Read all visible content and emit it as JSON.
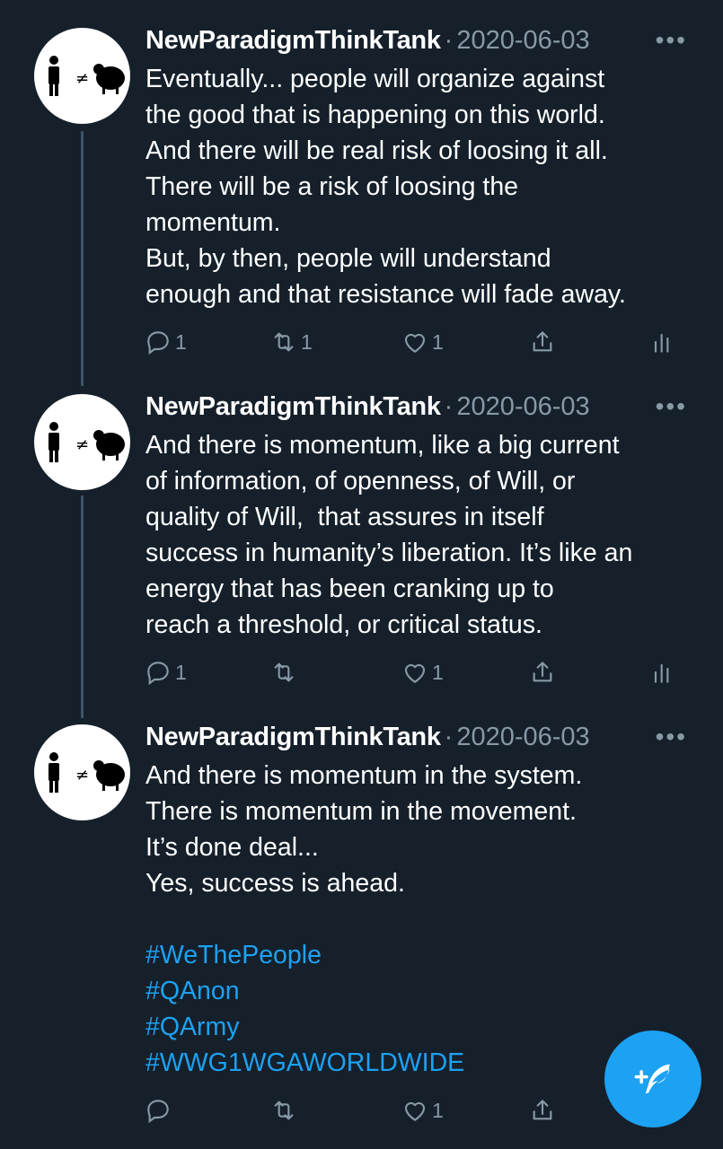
{
  "tweets": [
    {
      "name": "NewParadigmThinkTank",
      "separator": "·",
      "date": "2020-06-03",
      "more": "•••",
      "text": "Eventually... people will organize against\nthe good that is happening on this world.\nAnd there will be real risk of loosing it all.\nThere will be a risk of loosing the\nmomentum.\nBut, by then, people will understand\nenough and that resistance will fade away.",
      "hashtags": [],
      "reply_count": "1",
      "retweet_count": "1",
      "like_count": "1"
    },
    {
      "name": "NewParadigmThinkTank",
      "separator": "·",
      "date": "2020-06-03",
      "more": "•••",
      "text": "And there is momentum, like a big current\nof information, of openness, of Will, or\nquality of Will,  that assures in itself\nsuccess in humanity’s liberation. It’s like an\nenergy that has been cranking up to\nreach a threshold, or critical status.",
      "hashtags": [],
      "reply_count": "1",
      "retweet_count": "",
      "like_count": "1"
    },
    {
      "name": "NewParadigmThinkTank",
      "separator": "·",
      "date": "2020-06-03",
      "more": "•••",
      "text": "And there is momentum in the system.\nThere is momentum in the movement.\nIt’s done deal...\nYes, success is ahead.",
      "hashtags": [
        "#WeThePeople",
        "#QAnon",
        "#QArmy",
        "#WWG1WGAWORLDWIDE"
      ],
      "reply_count": "",
      "retweet_count": "",
      "like_count": "1"
    }
  ],
  "avatar_symbol": "≠",
  "icons": {
    "reply": "reply-icon",
    "retweet": "retweet-icon",
    "like": "heart-icon",
    "share": "share-icon",
    "analytics": "analytics-icon",
    "compose": "compose-tweet-icon"
  },
  "colors": {
    "background": "#15202b",
    "text": "#ffffff",
    "muted": "#8899a6",
    "accent": "#1da1f2",
    "thread_line": "#3d5466"
  }
}
